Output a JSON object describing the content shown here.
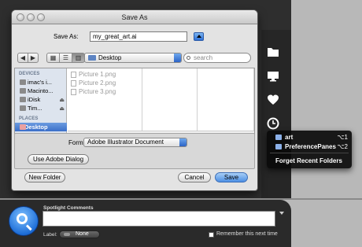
{
  "dialog": {
    "title": "Save As",
    "save_as_label": "Save As:",
    "filename": "my_great_art.ai",
    "location": "Desktop",
    "search_placeholder": "search",
    "sidebar": {
      "devices_header": "DEVICES",
      "devices": [
        "imac's i...",
        "Macinto...",
        "iDisk",
        "Tim..."
      ],
      "places_header": "PLACES",
      "places_selected": "Desktop"
    },
    "files": [
      "Picture 1.png",
      "Picture 2.png",
      "Picture 3.png"
    ],
    "format_label": "Format:",
    "format_value": "Adobe Illustrator Document",
    "use_adobe_dialog": "Use Adobe Dialog",
    "new_folder": "New Folder",
    "cancel": "Cancel",
    "save": "Save"
  },
  "recent_menu": {
    "items": [
      {
        "label": "art",
        "shortcut": "⌥1"
      },
      {
        "label": "PreferencePanes",
        "shortcut": "⌥2"
      }
    ],
    "forget": "Forget Recent Folders"
  },
  "spotlight": {
    "comments_title": "Spotlight Comments",
    "label_text": "Label:",
    "label_value": "None",
    "remember": "Remember this next time"
  },
  "colors": {
    "accent": "#3b6fc9",
    "panel": "#2e2e2e"
  }
}
